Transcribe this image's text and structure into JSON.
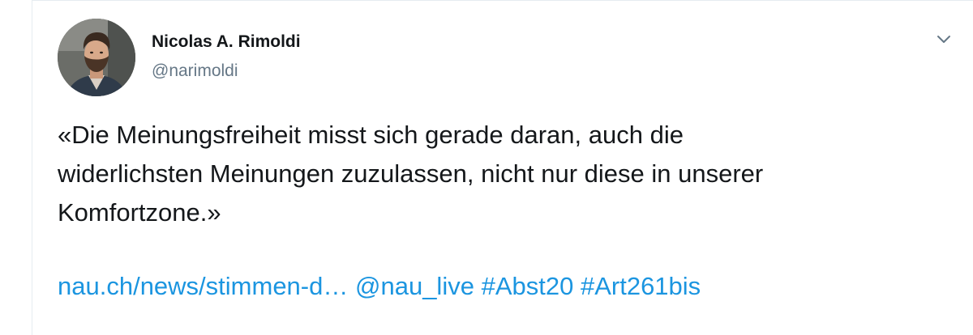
{
  "tweet": {
    "author": {
      "name": "Nicolas A. Rimoldi",
      "handle": "@narimoldi",
      "avatar_icon": "profile-photo"
    },
    "menu_icon": "chevron-down-icon",
    "text_lines": [
      "«Die Meinungsfreiheit misst sich gerade daran, auch die",
      "widerlichsten Meinungen zuzulassen, nicht nur diese in unserer",
      "Komfortzone.»"
    ],
    "links": {
      "url": "nau.ch/news/stimmen-d…",
      "mention": "@nau_live",
      "hashtag_1": "#Abst20",
      "hashtag_2": "#Art261bis"
    }
  },
  "colors": {
    "text": "#14171a",
    "secondary": "#657786",
    "link": "#1b95e0",
    "border": "#e6ecf0"
  }
}
